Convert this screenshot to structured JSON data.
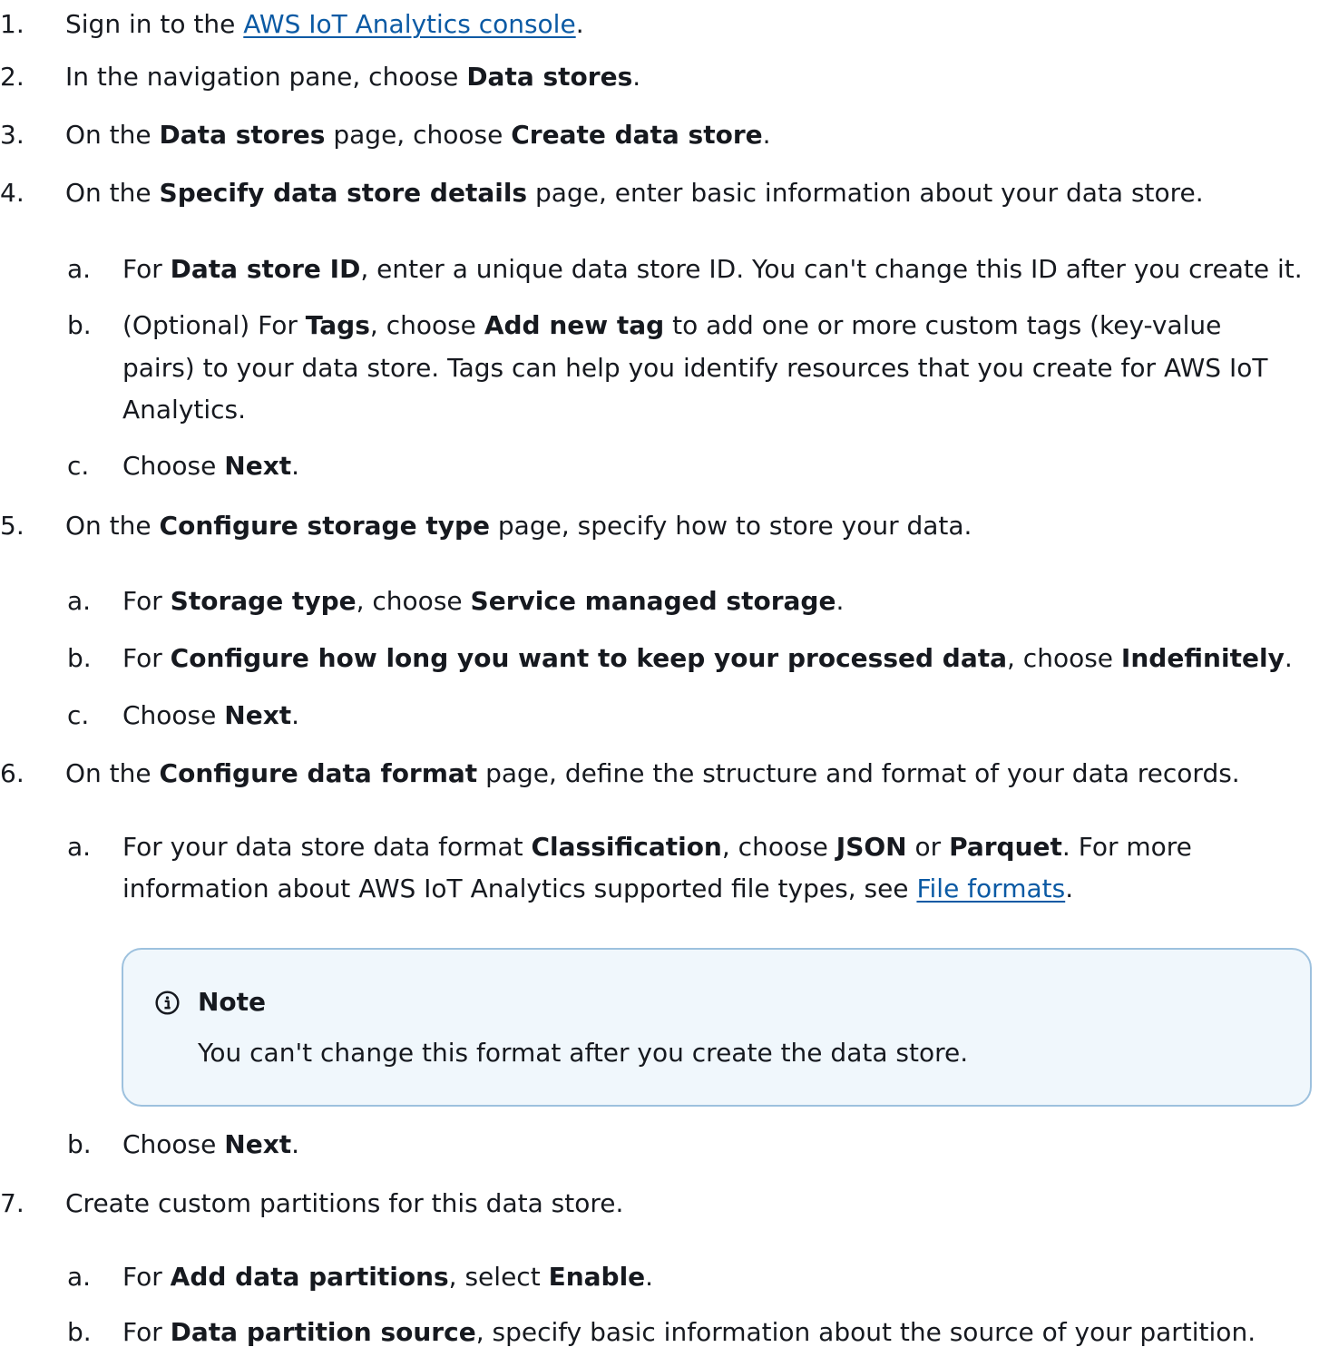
{
  "steps": [
    {
      "n": "1.",
      "pre": "Sign in to the ",
      "link": "AWS IoT Analytics console",
      "post": "."
    },
    {
      "n": "2.",
      "pre": "In the navigation pane, choose ",
      "b1": "Data stores",
      "post": "."
    },
    {
      "n": "3.",
      "pre": "On the ",
      "b1": "Data stores",
      "mid": " page, choose ",
      "b2": "Create data store",
      "post": "."
    },
    {
      "n": "4.",
      "pre": "On the ",
      "b1": "Specify data store details",
      "post": " page, enter basic information about your data store."
    },
    {
      "n": "5.",
      "pre": "On the ",
      "b1": "Configure storage type",
      "post": " page, specify how to store your data."
    },
    {
      "n": "6.",
      "pre": "On the ",
      "b1": "Configure data format",
      "post": " page, define the structure and format of your data records."
    },
    {
      "n": "7.",
      "text": "Create custom partitions for this data store."
    }
  ],
  "s4": {
    "a": {
      "n": "a.",
      "pre": "For ",
      "b1": "Data store ID",
      "post": ", enter a unique data store ID. You can't change this ID after you create it."
    },
    "b": {
      "n": "b.",
      "pre": "(Optional) For ",
      "b1": "Tags",
      "mid": ", choose ",
      "b2": "Add new tag",
      "post": " to add one or more custom tags (key-value",
      "line2": "pairs) to your data store. Tags can help you identify resources that you create for AWS IoT",
      "line3": "Analytics."
    },
    "c": {
      "n": "c.",
      "pre": "Choose ",
      "b1": "Next",
      "post": "."
    }
  },
  "s5": {
    "a": {
      "n": "a.",
      "pre": "For ",
      "b1": "Storage type",
      "mid": ", choose ",
      "b2": "Service managed storage",
      "post": "."
    },
    "b": {
      "n": "b.",
      "pre": "For ",
      "b1": "Configure how long you want to keep your processed data",
      "mid": ", choose ",
      "b2": "Indefinitely",
      "post": "."
    },
    "c": {
      "n": "c.",
      "pre": "Choose ",
      "b1": "Next",
      "post": "."
    }
  },
  "s6": {
    "a": {
      "n": "a.",
      "pre": "For your data store data format ",
      "b1": "Classification",
      "mid": ", choose ",
      "b2": "JSON",
      "mid2": " or ",
      "b3": "Parquet",
      "post": ". For more",
      "line2_pre": "information about AWS IoT Analytics supported file types, see ",
      "link": "File formats",
      "line2_post": "."
    },
    "b": {
      "n": "b.",
      "pre": "Choose ",
      "b1": "Next",
      "post": "."
    }
  },
  "note": {
    "title": "Note",
    "body": "You can't change this format after you create the data store.",
    "icon": "info-icon"
  },
  "s7": {
    "a": {
      "n": "a.",
      "pre": "For ",
      "b1": "Add data partitions",
      "mid": ", select ",
      "b2": "Enable",
      "post": "."
    },
    "b": {
      "n": "b.",
      "pre": "For ",
      "b1": "Data partition source",
      "post": ", specify basic information about the source of your partition."
    }
  },
  "colors": {
    "link": "#0b5aa4",
    "note_border": "#9dc1de",
    "note_bg": "#f0f7fc",
    "text": "#16191f"
  }
}
